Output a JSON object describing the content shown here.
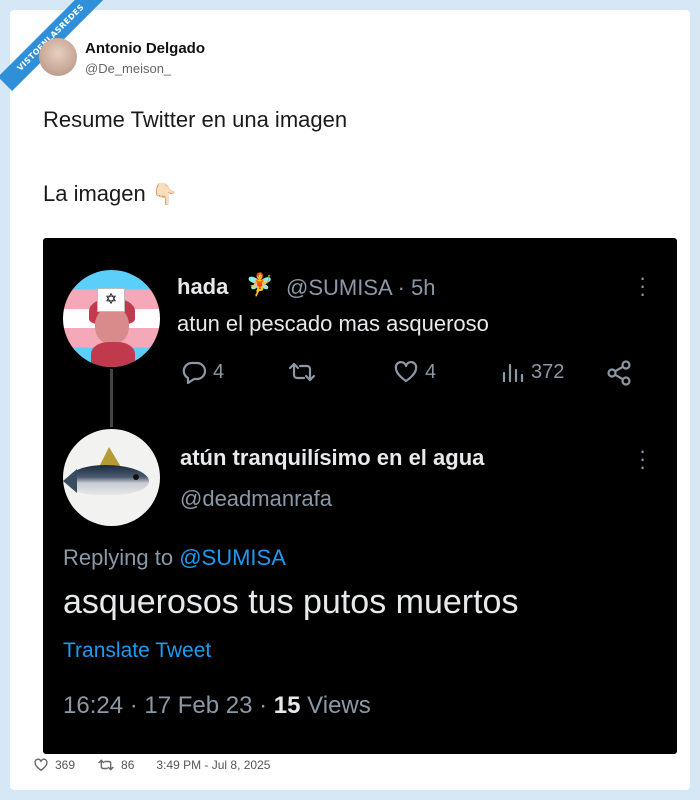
{
  "watermark": "VISTOENLASREDES",
  "author": {
    "name": "Antonio Delgado",
    "handle": "@De_meison_"
  },
  "tweet": {
    "line1": "Resume Twitter en una imagen",
    "line2": "La imagen",
    "emoji": "👇🏻"
  },
  "embedded": {
    "original": {
      "name": "hada",
      "name_emoji": "🧚",
      "handle_time": "@SUMISA · 5h",
      "text": "atun el pescado mas asqueroso",
      "counts": {
        "replies": "4",
        "likes": "4",
        "views": "372"
      }
    },
    "reply": {
      "name": "atún tranquilísimo en el agua",
      "handle": "@deadmanrafa",
      "replying_prefix": "Replying to ",
      "replying_mention": "@SUMISA",
      "text": "asquerosos tus putos muertos",
      "translate": "Translate Tweet",
      "meta_prefix": "16:24 · 17 Feb 23 · ",
      "views_count": "15",
      "views_label": " Views"
    }
  },
  "footer": {
    "likes": "369",
    "retweets": "86",
    "timestamp": "3:49 PM - Jul 8, 2025"
  },
  "icons": {
    "reply": "reply-icon",
    "retweet": "retweet-icon",
    "like": "heart-icon",
    "views": "views-icon",
    "share": "share-icon",
    "more": "more-icon"
  },
  "colors": {
    "page_bg": "#d6e8f6",
    "embed_bg": "#000000",
    "link_blue": "#1d9bf0",
    "muted": "#8b98a5"
  }
}
